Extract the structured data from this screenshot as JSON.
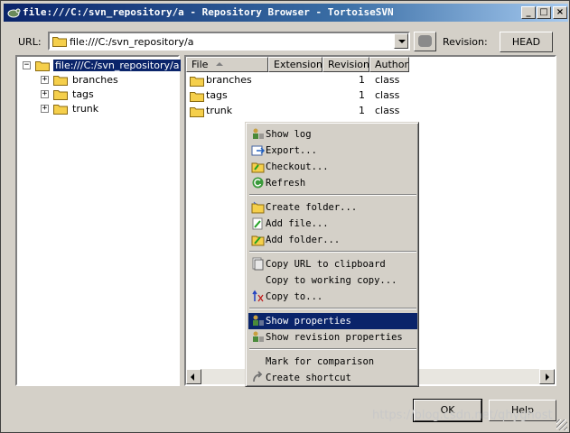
{
  "window": {
    "title": "file:///C:/svn_repository/a - Repository Browser - TortoiseSVN",
    "minimize_glyph": "_",
    "maximize_glyph": "□",
    "close_glyph": "×"
  },
  "toolbar": {
    "url_label": "URL:",
    "url_value": "file:///C:/svn_repository/a",
    "revision_label": "Revision:",
    "revision_button": "HEAD"
  },
  "tree": {
    "root": {
      "label": "file:///C:/svn_repository/a",
      "expander": "−"
    },
    "children": [
      {
        "label": "branches",
        "expander": "+"
      },
      {
        "label": "tags",
        "expander": "+"
      },
      {
        "label": "trunk",
        "expander": "+"
      }
    ]
  },
  "list": {
    "columns": [
      "File",
      "Extension",
      "Revision",
      "Author"
    ],
    "rows": [
      {
        "file": "branches",
        "extension": "",
        "revision": "1",
        "author": "class"
      },
      {
        "file": "tags",
        "extension": "",
        "revision": "1",
        "author": "class"
      },
      {
        "file": "trunk",
        "extension": "",
        "revision": "1",
        "author": "class"
      }
    ]
  },
  "context_menu": {
    "items": [
      {
        "label": "Show log",
        "icon": "show-log-icon"
      },
      {
        "label": "Export...",
        "icon": "export-icon"
      },
      {
        "label": "Checkout...",
        "icon": "checkout-icon"
      },
      {
        "label": "Refresh",
        "icon": "refresh-icon"
      },
      {
        "label": "Create folder...",
        "icon": "create-folder-icon"
      },
      {
        "label": "Add file...",
        "icon": "add-file-icon"
      },
      {
        "label": "Add folder...",
        "icon": "add-folder-icon"
      },
      {
        "label": "Copy URL to clipboard",
        "icon": "copy-url-icon"
      },
      {
        "label": "Copy to working copy...",
        "icon": ""
      },
      {
        "label": "Copy to...",
        "icon": "copy-to-icon"
      },
      {
        "label": "Show properties",
        "icon": "properties-icon",
        "highlighted": true
      },
      {
        "label": "Show revision properties",
        "icon": "revision-properties-icon"
      },
      {
        "label": "Mark for comparison",
        "icon": ""
      },
      {
        "label": "Create shortcut",
        "icon": "shortcut-icon"
      }
    ]
  },
  "buttons": {
    "ok": "OK",
    "help": "Help"
  },
  "watermark": "https://blog.csdn.net/qhyghost",
  "colors": {
    "title_bar": "#0a246a",
    "selection": "#0a246a",
    "window_bg": "#d4d0c8",
    "folder": "#f5cf4b"
  }
}
